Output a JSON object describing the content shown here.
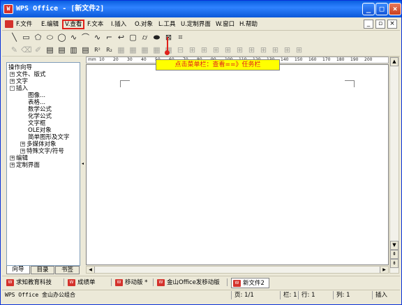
{
  "window": {
    "title": "WPS Office - [新文件2]",
    "icon": "wps-icon",
    "controls": [
      "_",
      "□",
      "×"
    ]
  },
  "menu": {
    "items": [
      "F.文件",
      "E.编辑",
      "V.查看",
      "F.文本",
      "I.插入",
      "O.对象",
      "L.工具",
      "U.定制界面",
      "W.窗口",
      "H.帮助"
    ],
    "active_index": 2,
    "mdi_controls": [
      "_",
      "▫",
      "×"
    ]
  },
  "toolbar1": {
    "tools": [
      "╲",
      "▭",
      "⬠",
      "⬭",
      "◯",
      "∿",
      "⌒",
      "∿",
      "⌐",
      "↩",
      "▢",
      "⌭",
      "⬬",
      "⊠",
      "⌗"
    ]
  },
  "toolbar2": {
    "tools": [
      "✎",
      "⌫",
      "✐",
      "▤",
      "▤",
      "▥",
      "▤",
      "R²",
      "R₂",
      "▦",
      "▦",
      "▦",
      "▦",
      "▦",
      "⊟",
      "⊞",
      "⊞",
      "⊞",
      "⊞",
      "⊞",
      "⊞",
      "⊞",
      "⊞",
      "⊞",
      "⊞",
      "⊞"
    ]
  },
  "callout": {
    "text": "点击菜单栏：查看==》任务栏",
    "color": "#e0201a",
    "background": "#ffff00"
  },
  "ruler": {
    "numbers": [
      "10",
      "20",
      "30",
      "40",
      "50",
      "60",
      "70",
      "80",
      "90",
      "100",
      "110",
      "120",
      "130",
      "140",
      "150",
      "160",
      "170",
      "180",
      "190",
      "200"
    ],
    "unit": "mm"
  },
  "sidepanel": {
    "title": "操作向导",
    "tree": [
      {
        "label": "文件、版式",
        "level": 0,
        "expander": "+"
      },
      {
        "label": "文字",
        "level": 0,
        "expander": "+"
      },
      {
        "label": "插入",
        "level": 0,
        "expander": "-"
      },
      {
        "label": "图像...",
        "level": 1,
        "expander": ""
      },
      {
        "label": "表格...",
        "level": 1,
        "expander": ""
      },
      {
        "label": "数学公式",
        "level": 1,
        "expander": ""
      },
      {
        "label": "化学公式",
        "level": 1,
        "expander": ""
      },
      {
        "label": "文字框",
        "level": 1,
        "expander": ""
      },
      {
        "label": "OLE对象",
        "level": 1,
        "expander": ""
      },
      {
        "label": "简单图形及文字",
        "level": 1,
        "expander": ""
      },
      {
        "label": "多媒体对象",
        "level": 1,
        "expander": "+"
      },
      {
        "label": "特殊文字/符号",
        "level": 1,
        "expander": "+"
      },
      {
        "label": "编辑",
        "level": 0,
        "expander": "+"
      },
      {
        "label": "定制界面",
        "level": 0,
        "expander": "+"
      }
    ],
    "tabs": [
      "向导",
      "目录",
      "书签"
    ],
    "active_tab": 0
  },
  "doc_tabs": {
    "tabs": [
      {
        "label": "求知教育科技",
        "active": false
      },
      {
        "label": "成绩单",
        "active": false
      },
      {
        "label": "移动版 *",
        "active": false
      },
      {
        "label": "金山Office发移动版",
        "active": false
      },
      {
        "label": "新文件2",
        "active": true
      }
    ]
  },
  "status": {
    "app": "WPS Office 金山办公组合",
    "page": "页: 1/1",
    "column": "栏: 1",
    "row": "行: 1",
    "col": "列: 1",
    "mode": "插入"
  }
}
